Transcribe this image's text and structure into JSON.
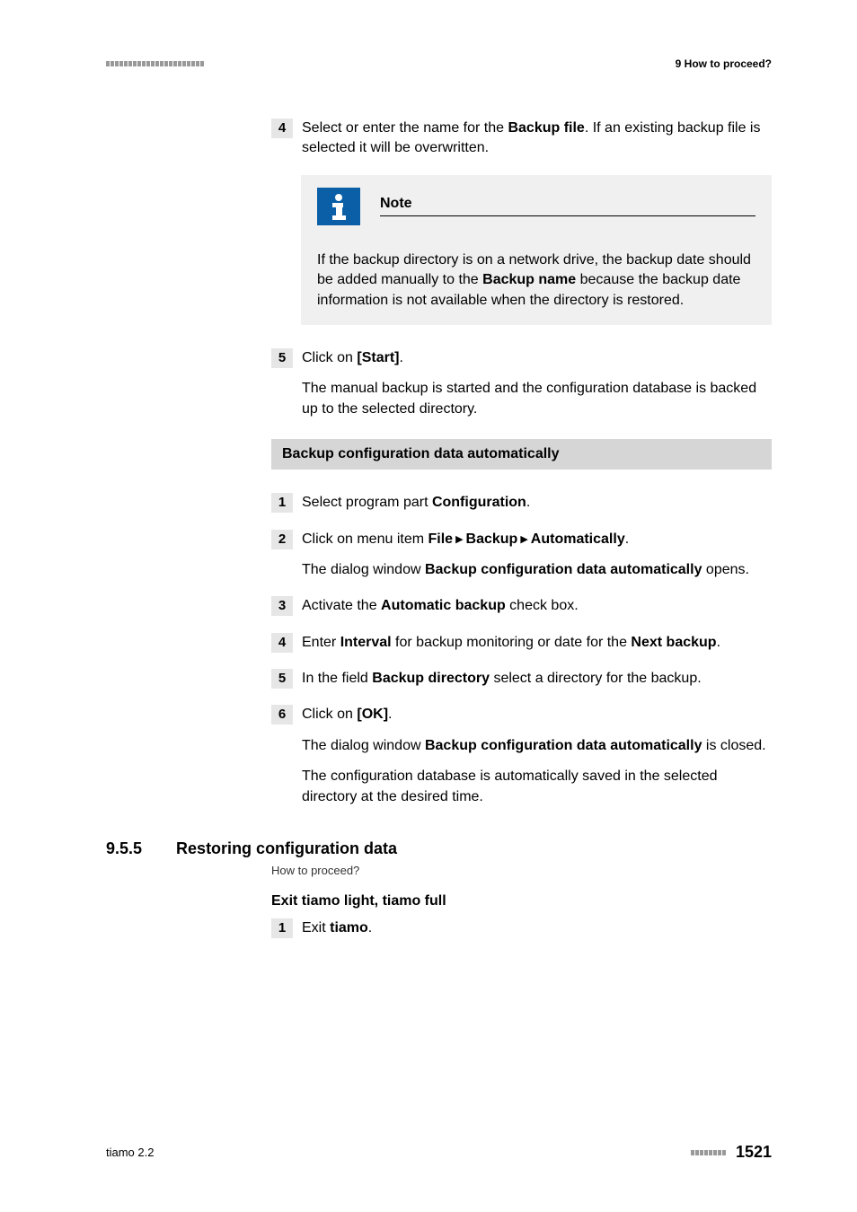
{
  "header": {
    "right": "9 How to proceed?"
  },
  "firstBlock": {
    "step4": {
      "num": "4",
      "text": "Select or enter the name for the ",
      "bold": "Backup file",
      "text2": ". If an existing backup file is selected it will be overwritten."
    },
    "note": {
      "title": "Note",
      "body_pre": "If the backup directory is on a network drive, the backup date should be added manually to the ",
      "body_bold": "Backup name",
      "body_post": " because the backup date information is not available when the directory is restored."
    },
    "step5": {
      "num": "5",
      "line1_pre": "Click on ",
      "line1_bold": "[Start]",
      "line1_post": ".",
      "line2": "The manual backup is started and the configuration database is backed up to the selected directory."
    }
  },
  "sectionBar": "Backup configuration data automatically",
  "auto": {
    "s1": {
      "num": "1",
      "pre": "Select program part ",
      "bold": "Configuration",
      "post": "."
    },
    "s2": {
      "num": "2",
      "line1_pre": "Click on menu item ",
      "m1": "File",
      "m2": "Backup",
      "m3": "Automatically",
      "line1_post": ".",
      "line2_pre": "The dialog window ",
      "line2_bold": "Backup configuration data automatically",
      "line2_post": " opens."
    },
    "s3": {
      "num": "3",
      "pre": "Activate the ",
      "bold": "Automatic backup",
      "post": " check box."
    },
    "s4": {
      "num": "4",
      "pre": "Enter ",
      "bold1": "Interval",
      "mid": " for backup monitoring or date for the ",
      "bold2": "Next backup",
      "post": "."
    },
    "s5": {
      "num": "5",
      "pre": "In the field ",
      "bold": "Backup directory",
      "post": " select a directory for the backup."
    },
    "s6": {
      "num": "6",
      "l1_pre": "Click on ",
      "l1_bold": "[OK]",
      "l1_post": ".",
      "l2_pre": "The dialog window ",
      "l2_bold": "Backup configuration data automatically",
      "l2_post": " is closed.",
      "l3": "The configuration database is automatically saved in the selected directory at the desired time."
    }
  },
  "sec955": {
    "num": "9.5.5",
    "title": "Restoring configuration data",
    "small": "How to proceed?",
    "sub": "Exit tiamo light, tiamo full",
    "s1": {
      "num": "1",
      "pre": "Exit ",
      "bold": "tiamo",
      "post": "."
    }
  },
  "footer": {
    "left": "tiamo 2.2",
    "page": "1521"
  }
}
